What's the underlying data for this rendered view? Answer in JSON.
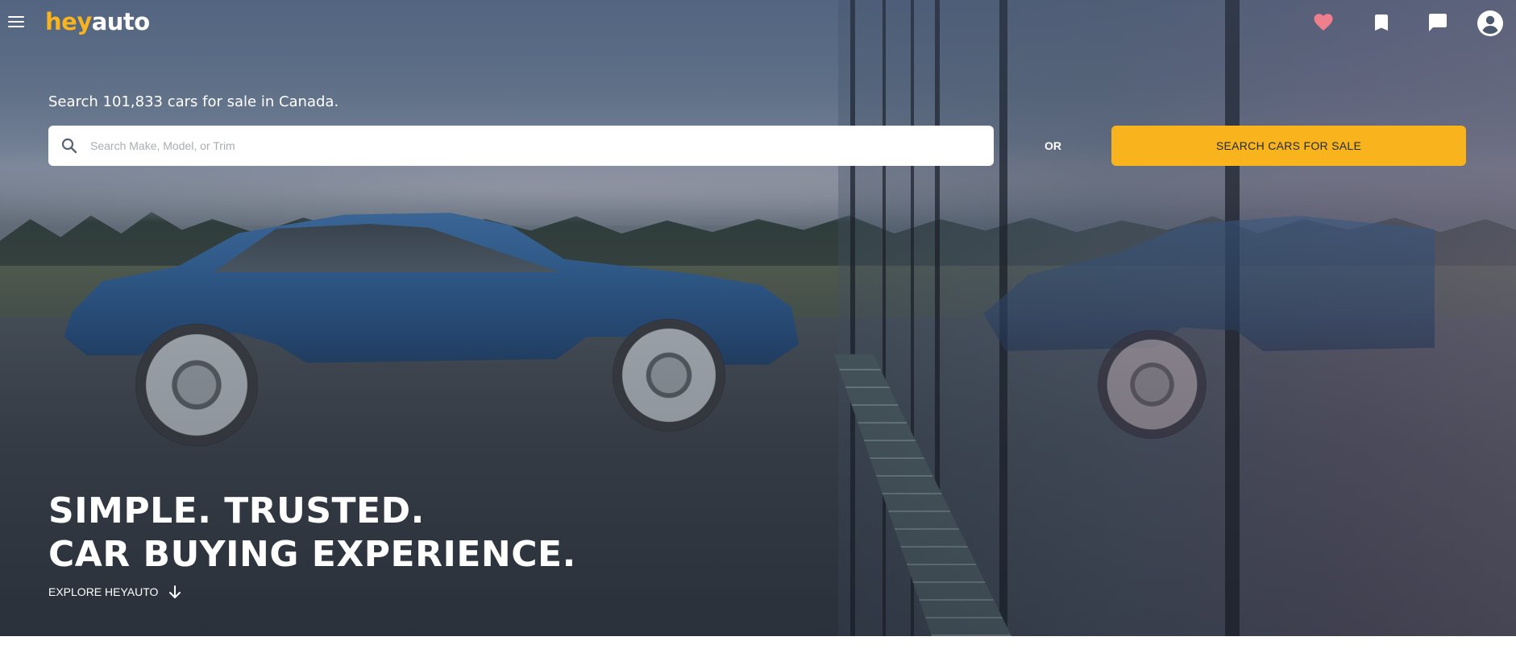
{
  "header": {
    "logo": {
      "part1": "hey",
      "part2": "auto"
    },
    "icons": {
      "menu": "menu-icon",
      "favorites": "heart-icon",
      "saved": "bookmark-icon",
      "messages": "chat-icon",
      "account": "account-circle-icon"
    }
  },
  "search": {
    "tagline": "Search 101,833 cars for sale in Canada.",
    "placeholder": "Search Make, Model, or Trim",
    "value": "",
    "or_label": "OR",
    "cta_label": "SEARCH CARS FOR SALE"
  },
  "hero": {
    "headline_line1": "SIMPLE. TRUSTED.",
    "headline_line2": "CAR BUYING EXPERIENCE.",
    "explore_label": "EXPLORE HEYAUTO"
  },
  "colors": {
    "brand_yellow": "#f9b31c",
    "favorite_pink": "#f07f8e",
    "text_white": "#ffffff"
  }
}
